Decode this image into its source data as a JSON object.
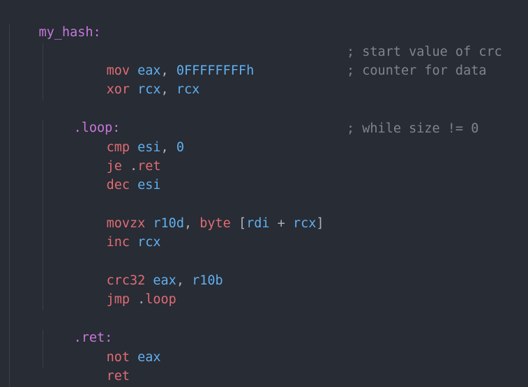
{
  "code": {
    "func_label": "my_hash:",
    "l_mov": {
      "op": "mov",
      "dst": "eax",
      "sep": ", ",
      "src": "0FFFFFFFFh",
      "comment": "; start value of crc"
    },
    "l_xor": {
      "op": "xor",
      "dst": "rcx",
      "sep": ", ",
      "src": "rcx",
      "comment": "; counter for data"
    },
    "loop_label": ".loop:",
    "l_cmp": {
      "op": "cmp",
      "dst": "esi",
      "sep": ", ",
      "src": "0",
      "comment": "; while size != 0"
    },
    "l_je": {
      "op": "je",
      "dot": ".",
      "target": "ret"
    },
    "l_dec": {
      "op": "dec",
      "dst": "esi"
    },
    "l_movzx": {
      "op": "movzx",
      "dst": "r10d",
      "sep": ", ",
      "size": "byte",
      "lb": " [",
      "base": "rdi",
      "plus": " + ",
      "index": "rcx",
      "rb": "]"
    },
    "l_inc": {
      "op": "inc",
      "dst": "rcx"
    },
    "l_crc": {
      "op": "crc32",
      "dst": "eax",
      "sep": ", ",
      "src": "r10b"
    },
    "l_jmp": {
      "op": "jmp",
      "dot": " .",
      "target": "loop"
    },
    "ret_label": ".ret:",
    "l_not": {
      "op": "not",
      "dst": "eax"
    },
    "l_ret": {
      "op": "ret"
    }
  },
  "colors": {
    "background": "#282c34",
    "label": "#c678dd",
    "keyword": "#e06c75",
    "register": "#61afef",
    "comment": "#7f848e",
    "indent_guide": "#3b4048"
  }
}
